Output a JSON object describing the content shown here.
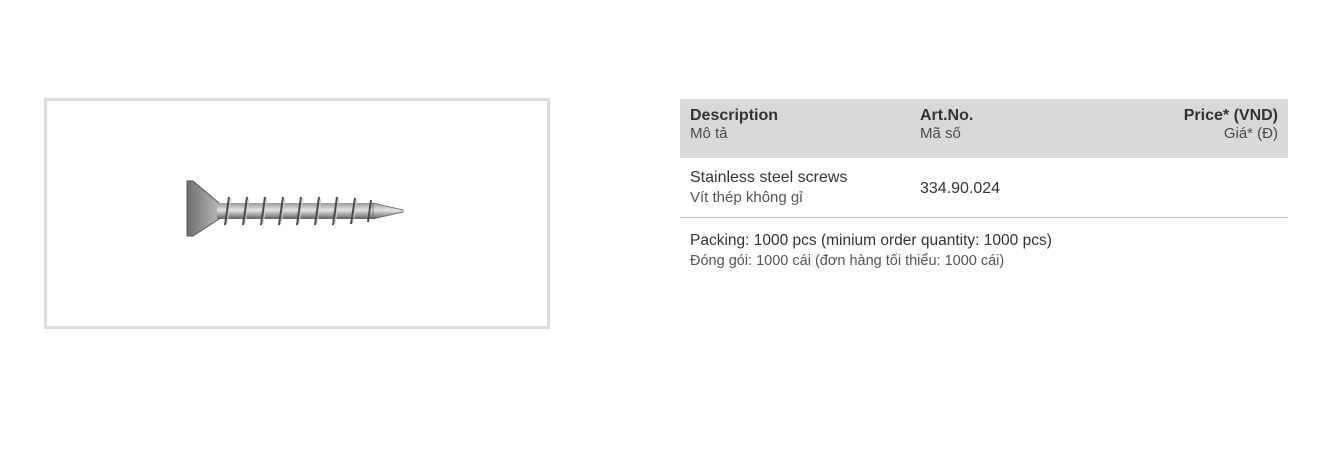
{
  "product_image": {
    "icon": "screw-icon"
  },
  "table": {
    "header": {
      "description_en": "Description",
      "description_vi": "Mô tả",
      "artno_en": "Art.No.",
      "artno_vi": "Mã số",
      "price_en": "Price* (VND)",
      "price_vi": "Giá* (Đ)"
    },
    "rows": [
      {
        "description_en": "Stainless steel screws",
        "description_vi": "Vít thép không gỉ",
        "art_no": "334.90.024",
        "price": ""
      }
    ],
    "packing_en": "Packing: 1000 pcs (minium order quantity: 1000 pcs)",
    "packing_vi": "Đóng gói: 1000 cái (đơn hàng tối thiểu: 1000 cái)"
  },
  "colors": {
    "header_bg": "#d9d9d9",
    "frame_border": "#dcdcdc",
    "rule": "#bfbfbf"
  }
}
